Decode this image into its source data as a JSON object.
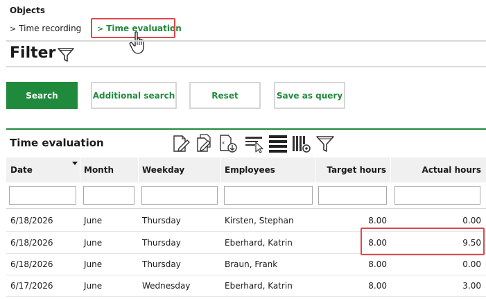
{
  "objects": {
    "title": "Objects",
    "links": [
      {
        "chevron": ">",
        "label": "Time recording"
      },
      {
        "chevron": ">",
        "label": "Time evaluation"
      }
    ]
  },
  "filter": {
    "title": "Filter",
    "icon": "funnel-icon"
  },
  "buttons": {
    "search": "Search",
    "additional_search": "Additional search",
    "reset": "Reset",
    "save_as_query": "Save as query"
  },
  "section": {
    "title": "Time evaluation",
    "toolbar_icons": [
      "edit-document-icon",
      "copy-document-icon",
      "export-document-icon",
      "select-columns-icon",
      "rows-view-icon",
      "column-settings-icon",
      "funnel-icon"
    ]
  },
  "table": {
    "columns": [
      "Date",
      "Month",
      "Weekday",
      "Employees",
      "Target hours",
      "Actual hours"
    ],
    "sorted_column": "Date",
    "filters": [
      "",
      "",
      "",
      "",
      "",
      ""
    ],
    "rows": [
      [
        "6/18/2026",
        "June",
        "Thursday",
        "Kirsten, Stephan",
        "8.00",
        "0.00"
      ],
      [
        "6/18/2026",
        "June",
        "Thursday",
        "Eberhard, Katrin",
        "8.00",
        "9.50"
      ],
      [
        "6/18/2026",
        "June",
        "Thursday",
        "Braun, Frank",
        "8.00",
        "0.00"
      ],
      [
        "6/17/2026",
        "June",
        "Wednesday",
        "Eberhard, Katrin",
        "8.00",
        "3.00"
      ]
    ]
  },
  "colors": {
    "accent_green": "#1f8a3b",
    "highlight_red": "#e0474c",
    "header_gray": "#f0f0f0"
  }
}
